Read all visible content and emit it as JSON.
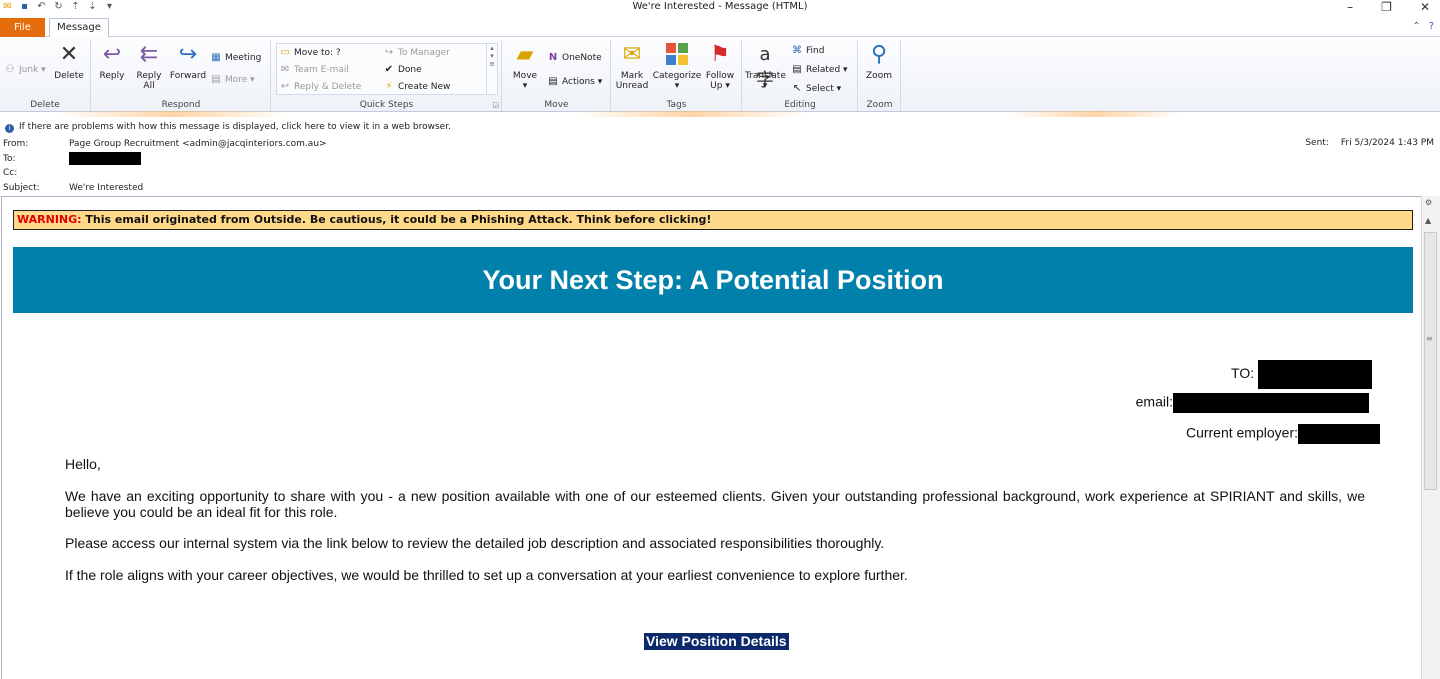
{
  "window": {
    "title": "We're Interested  -  Message (HTML)"
  },
  "tabs": {
    "file": "File",
    "message": "Message"
  },
  "ribbon": {
    "delete_group": {
      "label": "Delete",
      "junk": "Junk",
      "delete": "Delete"
    },
    "respond_group": {
      "label": "Respond",
      "reply": "Reply",
      "reply_all_1": "Reply",
      "reply_all_2": "All",
      "forward": "Forward",
      "meeting": "Meeting",
      "more": "More"
    },
    "quick_steps_group": {
      "label": "Quick Steps",
      "move_to": "Move to: ?",
      "team_email": "Team E-mail",
      "reply_delete": "Reply & Delete",
      "to_manager": "To Manager",
      "done": "Done",
      "create_new": "Create New"
    },
    "move_group": {
      "label": "Move",
      "move": "Move",
      "onenote": "OneNote",
      "actions": "Actions"
    },
    "tags_group": {
      "label": "Tags",
      "mark_unread_1": "Mark",
      "mark_unread_2": "Unread",
      "categorize": "Categorize",
      "follow_up_1": "Follow",
      "follow_up_2": "Up"
    },
    "editing_group": {
      "label": "Editing",
      "translate": "Translate",
      "find": "Find",
      "related": "Related",
      "select": "Select"
    },
    "zoom_group": {
      "label": "Zoom",
      "zoom": "Zoom"
    }
  },
  "header": {
    "infobar": "If there are problems with how this message is displayed, click here to view it in a web browser.",
    "from_label": "From:",
    "from_value": "Page Group Recruitment <admin@jacqinteriors.com.au>",
    "to_label": "To:",
    "cc_label": "Cc:",
    "subject_label": "Subject:",
    "subject_value": "We're Interested",
    "sent_label": "Sent:",
    "sent_value": "Fri 5/3/2024 1:43 PM"
  },
  "message": {
    "warning_prefix": "WARNING:",
    "warning_text": " This email originated from Outside. Be cautious, it could be a Phishing Attack. Think before clicking!",
    "banner": "Your Next Step: A Potential Position",
    "to_label": "TO:",
    "email_label": "email:",
    "employer_label": "Current employer:",
    "greeting": "Hello,",
    "para1": "We have an exciting opportunity to share with you - a new position available with one of our esteemed clients. Given your outstanding professional background, work experience at SPIRIANT and skills, we believe you could be an ideal fit for this role.",
    "para2": "Please access our internal system via the link below to review the detailed job description and associated responsibilities thoroughly.",
    "para3": "If the role aligns with your career objectives, we would be thrilled to set up a conversation at your earliest convenience to explore further.",
    "cta": "View Position Details"
  },
  "colors": {
    "file_tab": "#e46c0a",
    "banner": "#0080aa",
    "warning_bg": "#ffd98a",
    "warning_word": "#e00000",
    "cta_bg": "#0c2a6b"
  }
}
